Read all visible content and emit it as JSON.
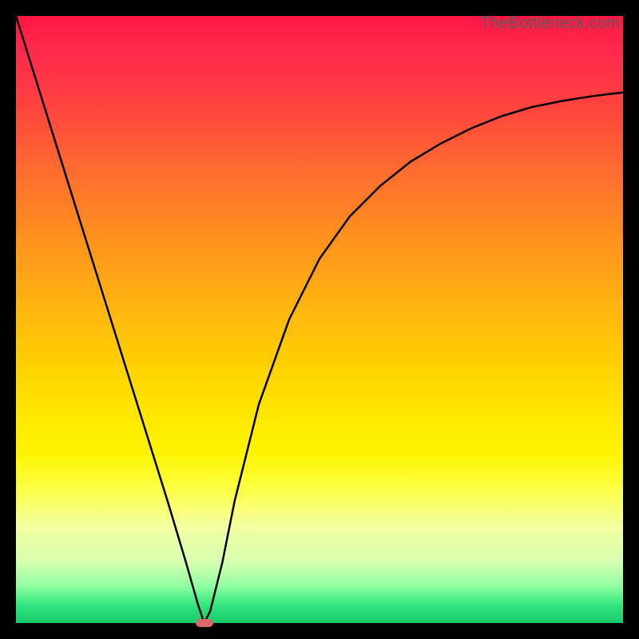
{
  "watermark": "TheBottleneck.com",
  "chart_data": {
    "type": "line",
    "title": "",
    "xlabel": "",
    "ylabel": "",
    "xlim": [
      0,
      100
    ],
    "ylim": [
      0,
      100
    ],
    "series": [
      {
        "name": "curve",
        "x": [
          0,
          5,
          10,
          15,
          20,
          25,
          28,
          30,
          31,
          32,
          34,
          36,
          40,
          45,
          50,
          55,
          60,
          65,
          70,
          75,
          80,
          85,
          90,
          95,
          100
        ],
        "values": [
          100,
          84,
          68,
          52,
          36,
          20,
          10,
          3,
          0,
          2,
          10,
          20,
          36,
          50,
          60,
          67,
          72,
          76,
          79,
          81.5,
          83.5,
          85,
          86,
          86.8,
          87.4
        ]
      }
    ],
    "marker": {
      "x": 31,
      "y": 0
    },
    "colors": {
      "curve": "#000000",
      "marker": "#d86a6a",
      "gradient_top": "#ff1744",
      "gradient_mid": "#ffd200",
      "gradient_bottom": "#19c96a"
    }
  }
}
